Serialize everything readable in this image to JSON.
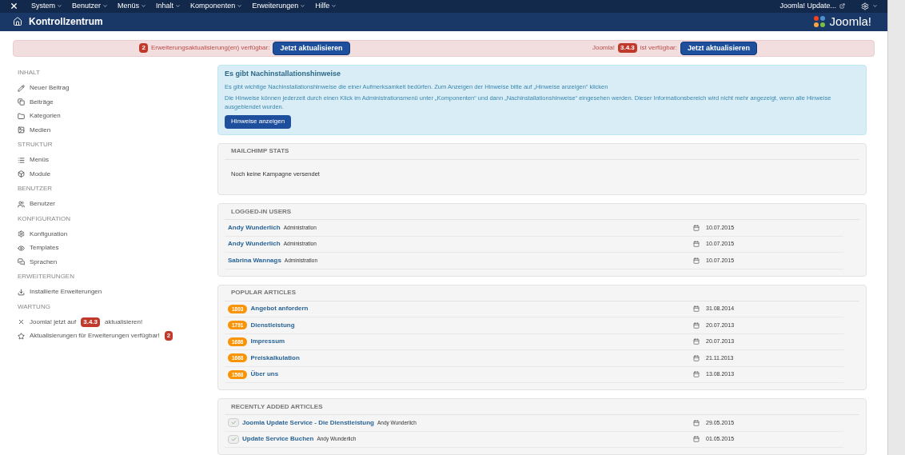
{
  "navbar": {
    "menus": [
      "System",
      "Benutzer",
      "Menüs",
      "Inhalt",
      "Komponenten",
      "Erweiterungen",
      "Hilfe"
    ],
    "update_link": "Joomla! Update..."
  },
  "header": {
    "title": "Kontrollzentrum",
    "logo_text": "Joomla!"
  },
  "alerts": [
    {
      "parts": [
        {
          "kind": "badge",
          "text": "2"
        },
        {
          "kind": "text",
          "text": "Erweiterungsaktualisierung(en) verfügbar:"
        },
        {
          "kind": "button",
          "text": "Jetzt aktualisieren"
        }
      ]
    },
    {
      "parts": [
        {
          "kind": "text",
          "text": "Joomla!"
        },
        {
          "kind": "badge",
          "text": "3.4.3"
        },
        {
          "kind": "text",
          "text": "ist verfügbar:"
        },
        {
          "kind": "button",
          "text": "Jetzt aktualisieren"
        }
      ]
    }
  ],
  "sidebar": [
    {
      "heading": "INHALT",
      "items": [
        {
          "parts": [
            {
              "kind": "text",
              "text": "Neuer Beitrag"
            }
          ]
        },
        {
          "parts": [
            {
              "kind": "text",
              "text": "Beiträge"
            }
          ]
        },
        {
          "parts": [
            {
              "kind": "text",
              "text": "Kategorien"
            }
          ]
        },
        {
          "parts": [
            {
              "kind": "text",
              "text": "Medien"
            }
          ]
        }
      ]
    },
    {
      "heading": "STRUKTUR",
      "items": [
        {
          "parts": [
            {
              "kind": "text",
              "text": "Menüs"
            }
          ]
        },
        {
          "parts": [
            {
              "kind": "text",
              "text": "Module"
            }
          ]
        }
      ]
    },
    {
      "heading": "BENUTZER",
      "items": [
        {
          "parts": [
            {
              "kind": "text",
              "text": "Benutzer"
            }
          ]
        }
      ]
    },
    {
      "heading": "KONFIGURATION",
      "items": [
        {
          "parts": [
            {
              "kind": "text",
              "text": "Konfiguration"
            }
          ]
        },
        {
          "parts": [
            {
              "kind": "text",
              "text": "Templates"
            }
          ]
        },
        {
          "parts": [
            {
              "kind": "text",
              "text": "Sprachen"
            }
          ]
        }
      ]
    },
    {
      "heading": "ERWEITERUNGEN",
      "items": [
        {
          "parts": [
            {
              "kind": "text",
              "text": "Installierte Erweiterungen"
            }
          ]
        }
      ]
    },
    {
      "heading": "WARTUNG",
      "items": [
        {
          "parts": [
            {
              "kind": "text",
              "text": "Joomla! jetzt auf"
            },
            {
              "kind": "badge",
              "text": "3.4.3"
            },
            {
              "kind": "text",
              "text": "aktualisieren!"
            }
          ]
        },
        {
          "parts": [
            {
              "kind": "text",
              "text": "Aktualisierungen für Erweiterungen verfügbar!"
            },
            {
              "kind": "badge",
              "text": "2"
            }
          ]
        }
      ]
    }
  ],
  "postinstall": {
    "title": "Es gibt Nachinstallationshinweise",
    "lines": [
      "Es gibt wichtige Nachinstallationshinweise die einer Aufmerksamkeit bedürfen. Zum Anzeigen der Hinweise bitte auf „Hinweise anzeigen“ klicken",
      "Die Hinweise können jederzeit durch einen Klick im Administrationsmenü unter „Komponenten“ und dann „Nachinstallationshinweise“ eingesehen werden. Dieser Informationsbereich wird nicht mehr angezeigt, wenn alle Hinweise ausgeblendet wurden."
    ],
    "button": "Hinweise anzeigen"
  },
  "mailchimp": {
    "title": "MAILCHIMP STATS",
    "text": "Noch keine Kampagne versendet"
  },
  "logged_in_users": {
    "title": "LOGGED-IN USERS",
    "rows": [
      {
        "name": "Andy Wunderlich",
        "role": "Administration",
        "date": "10.07.2015"
      },
      {
        "name": "Andy Wunderlich",
        "role": "Administration",
        "date": "10.07.2015"
      },
      {
        "name": "Sabrina Wannags",
        "role": "Administration",
        "date": "10.07.2015"
      }
    ]
  },
  "popular_articles": {
    "title": "POPULAR ARTICLES",
    "rows": [
      {
        "hits": "1803",
        "title": "Angebot anfordern",
        "date": "31.08.2014"
      },
      {
        "hits": "1791",
        "title": "Dienstleistung",
        "date": "20.07.2013"
      },
      {
        "hits": "1686",
        "title": "Impressum",
        "date": "20.07.2013"
      },
      {
        "hits": "1668",
        "title": "Preiskalkulation",
        "date": "21.11.2013"
      },
      {
        "hits": "1568",
        "title": "Über uns",
        "date": "13.08.2013"
      }
    ]
  },
  "recent_articles": {
    "title": "RECENTLY ADDED ARTICLES",
    "rows": [
      {
        "published": true,
        "title": "Joomla Update Service - Die Dienstleistung",
        "author": "Andy Wunderlich",
        "date": "29.05.2015"
      },
      {
        "published": true,
        "title": "Update Service Buchen",
        "author": "Andy Wunderlich",
        "date": "01.05.2015"
      }
    ]
  }
}
